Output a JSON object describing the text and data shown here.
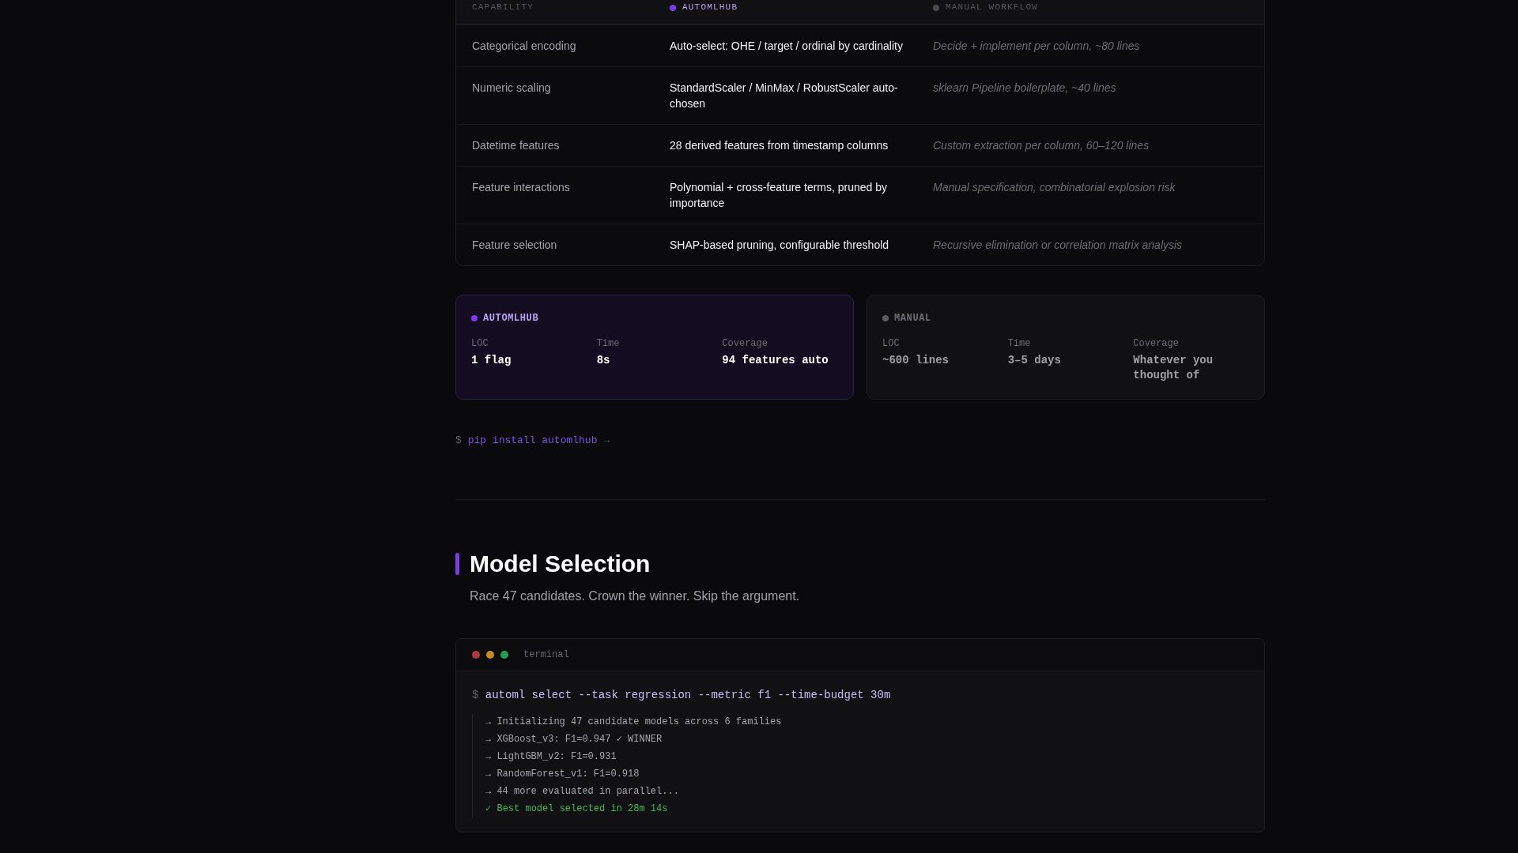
{
  "comparison_table": {
    "columns": [
      {
        "label": "CAPABILITY",
        "kind": "plain"
      },
      {
        "label": "AUTOMLHUB",
        "kind": "accent",
        "color": "#7c3aed"
      },
      {
        "label": "MANUAL WORKFLOW",
        "kind": "muted",
        "color": "#4a4a4f"
      }
    ],
    "rows": [
      {
        "cells": [
          "Categorical encoding",
          "Auto-select: OHE / target / ordinal by cardinality",
          "Decide + implement per column, ~80 lines"
        ]
      },
      {
        "cells": [
          "Numeric scaling",
          "StandardScaler / MinMax / RobustScaler auto-chosen",
          "sklearn Pipeline boilerplate, ~40 lines"
        ]
      },
      {
        "cells": [
          "Datetime features",
          "28 derived features from timestamp columns",
          "Custom extraction per column, 60–120 lines"
        ]
      },
      {
        "cells": [
          "Feature interactions",
          "Polynomial + cross-feature terms, pruned by importance",
          "Manual specification, combinatorial explosion risk"
        ]
      },
      {
        "cells": [
          "Feature selection",
          "SHAP-based pruning, configurable threshold",
          "Recursive elimination or correlation matrix analysis"
        ]
      }
    ]
  },
  "summary_cards": [
    {
      "title": "AUTOMLHUB",
      "kind": "highlight",
      "color": "#7c3aed",
      "stats": [
        {
          "label": "LOC",
          "value": "1 flag"
        },
        {
          "label": "Time",
          "value": "8s"
        },
        {
          "label": "Coverage",
          "value": "94 features auto"
        }
      ]
    },
    {
      "title": "MANUAL",
      "kind": "muted",
      "color": "#5c5c60",
      "stats": [
        {
          "label": "LOC",
          "value": "~600 lines"
        },
        {
          "label": "Time",
          "value": "3–5 days"
        },
        {
          "label": "Coverage",
          "value": "Whatever you thought of"
        }
      ]
    }
  ],
  "install_link": {
    "prompt": "$",
    "command": "pip install automlhub",
    "arrow": "→"
  },
  "section": {
    "title": "Model Selection",
    "subtitle": "Race 47 candidates. Crown the winner. Skip the argument."
  },
  "terminal": {
    "window_dots": [
      {
        "color": "#b4373c"
      },
      {
        "color": "#c28e1c"
      },
      {
        "color": "#23a04f"
      }
    ],
    "title": "terminal",
    "prompt": "$",
    "command": "automl select --task regression --metric f1 --time-budget 30m",
    "output": [
      {
        "kind": "info",
        "text": "→ Initializing 47 candidate models across 6 families"
      },
      {
        "kind": "info",
        "text": "→ XGBoost_v3: F1=0.947 ✓ WINNER"
      },
      {
        "kind": "info",
        "text": "→ LightGBM_v2: F1=0.931"
      },
      {
        "kind": "info",
        "text": "→ RandomForest_v1: F1=0.918"
      },
      {
        "kind": "info",
        "text": "→ 44 more evaluated in parallel..."
      },
      {
        "kind": "success",
        "text": "✓ Best model selected in 28m 14s"
      }
    ]
  }
}
